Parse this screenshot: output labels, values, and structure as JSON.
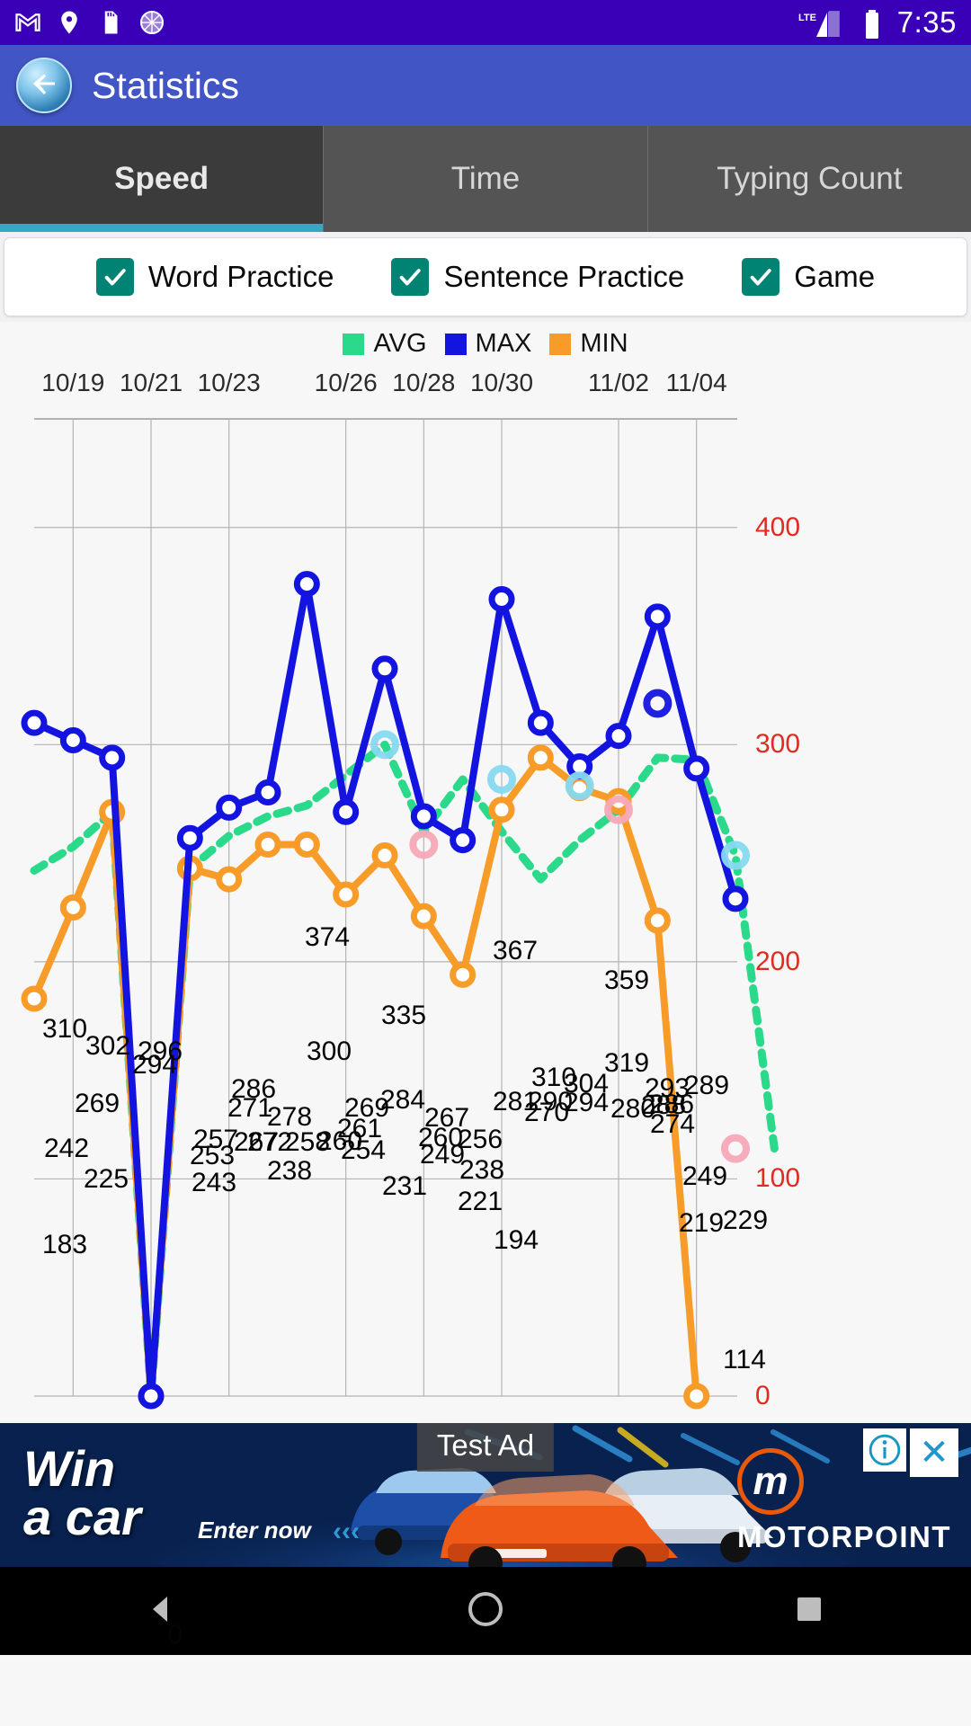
{
  "status_bar": {
    "time": "7:35",
    "network_label": "LTE",
    "icons": [
      "gmail-icon",
      "location-icon",
      "sd-card-icon",
      "circle-loading-icon"
    ]
  },
  "app_bar": {
    "title": "Statistics",
    "back_icon": "back-arrow-icon"
  },
  "tabs": [
    {
      "label": "Speed",
      "active": true
    },
    {
      "label": "Time",
      "active": false
    },
    {
      "label": "Typing Count",
      "active": false
    }
  ],
  "filters": [
    {
      "label": "Word Practice",
      "checked": true
    },
    {
      "label": "Sentence Practice",
      "checked": true
    },
    {
      "label": "Game",
      "checked": true
    }
  ],
  "colors": {
    "avg": "#2bd98a",
    "max": "#1414e0",
    "min": "#f79c28",
    "status_bar": "#3a00b8",
    "app_bar": "#4155c4",
    "tab_active": "#3b3b3b",
    "tab_indicator": "#39a7c4",
    "checkbox": "#018374",
    "axis_label": "#e02b20",
    "point_lightblue": "#87d9f0",
    "point_pink": "#f7a8b8"
  },
  "ad": {
    "overlay_label": "Test Ad",
    "headline_line1": "Win",
    "headline_line2": "a car",
    "cta": "Enter now",
    "chevrons": "‹‹‹",
    "brand": "MOTORPOINT",
    "logo_letter": "m",
    "info_icon": "info-icon",
    "close_icon": "close-icon"
  },
  "nav_bar": {
    "back": "triangle-back-icon",
    "home": "circle-home-icon",
    "recents": "square-recents-icon"
  },
  "chart_data": {
    "type": "line",
    "title": "",
    "xlabel": "",
    "ylabel": "",
    "ylim": [
      0,
      450
    ],
    "yticks": [
      0,
      100,
      200,
      300,
      400
    ],
    "ytick_labels": [
      "0",
      "100",
      "200",
      "300",
      "400"
    ],
    "grid": true,
    "legend_position": "top-center",
    "x_tick_labels": [
      "10/19",
      "10/21",
      "10/23",
      "10/26",
      "10/28",
      "10/30",
      "11/02",
      "11/04"
    ],
    "x_tick_indices": [
      1,
      3,
      5,
      8,
      10,
      12,
      15,
      17
    ],
    "n_points": 19,
    "series": [
      {
        "name": "AVG",
        "color": "#2bd98a",
        "style": "dotted",
        "values": [
          242,
          253,
          269,
          0,
          243,
          258,
          267,
          272,
          286,
          300,
          260,
          284,
          260,
          238,
          256,
          270,
          294,
          293,
          249,
          114
        ]
      },
      {
        "name": "MAX",
        "color": "#1414e0",
        "style": "solid",
        "values": [
          310,
          302,
          294,
          0,
          257,
          271,
          278,
          374,
          269,
          335,
          267,
          256,
          367,
          310,
          290,
          304,
          359,
          289,
          229
        ]
      },
      {
        "name": "MIN",
        "color": "#f79c28",
        "style": "solid",
        "values": [
          183,
          225,
          269,
          0,
          243,
          238,
          254,
          254,
          231,
          249,
          221,
          194,
          270,
          294,
          280,
          274,
          219,
          0
        ]
      }
    ],
    "point_labels": [
      "310",
      "302",
      "296",
      "294",
      "269",
      "242",
      "225",
      "183",
      "0",
      "257",
      "253",
      "243",
      "267",
      "272",
      "271",
      "286",
      "238",
      "278",
      "258",
      "260",
      "374",
      "300",
      "269",
      "261",
      "254",
      "335",
      "284",
      "231",
      "267",
      "260",
      "249",
      "256",
      "238",
      "367",
      "281",
      "270",
      "310",
      "290",
      "304",
      "294",
      "359",
      "319",
      "280",
      "293",
      "288",
      "286",
      "289",
      "274",
      "249",
      "219",
      "229",
      "114",
      "0"
    ]
  }
}
